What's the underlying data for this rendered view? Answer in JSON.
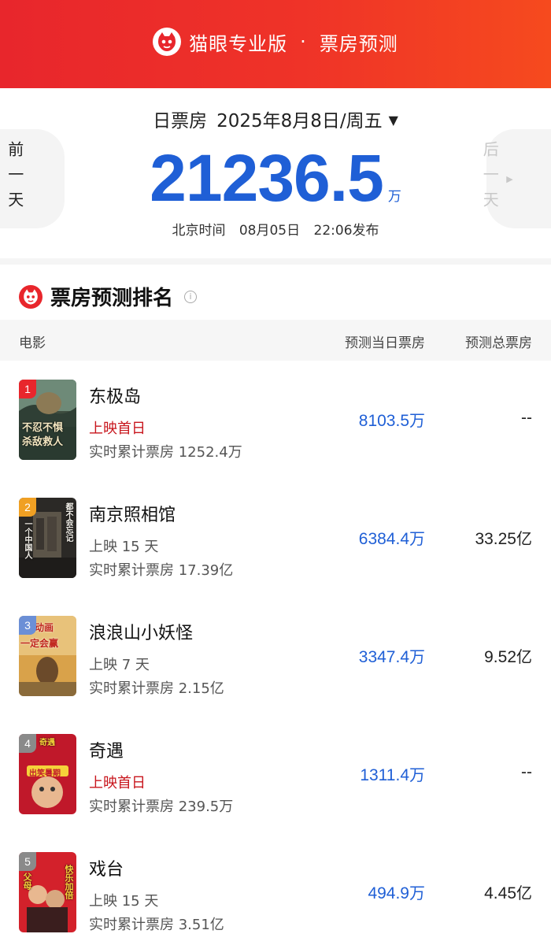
{
  "header": {
    "brand": "猫眼专业版",
    "separator": "·",
    "subtitle": "票房预测",
    "logo_icon": "cat-logo-icon"
  },
  "summary": {
    "label": "日票房",
    "date": "2025年8月8日/周五",
    "caret_icon": "caret-down-icon",
    "value": "21236.5",
    "unit": "万",
    "publish_prefix": "北京时间",
    "publish_date": "08月05日",
    "publish_time": "22:06发布",
    "prev_label": "前一天",
    "next_label": "后一天"
  },
  "ranking": {
    "title": "票房预测排名",
    "columns": [
      "电影",
      "预测当日票房",
      "预测总票房"
    ],
    "items": [
      {
        "rank": "1",
        "title": "东极岛",
        "status": "上映首日",
        "is_first_day": true,
        "cumulative": "实时累计票房 1252.4万",
        "daily_value": "8103.5",
        "daily_unit": "万",
        "total_value": "--",
        "total_unit": "",
        "poster_lines": [
          "不忍不惧",
          "杀敌救人"
        ],
        "badge_color": "#e8262c"
      },
      {
        "rank": "2",
        "title": "南京照相馆",
        "status": "上映 15 天",
        "is_first_day": false,
        "cumulative": "实时累计票房 17.39亿",
        "daily_value": "6384.4",
        "daily_unit": "万",
        "total_value": "33.25",
        "total_unit": "亿",
        "poster_lines": [
          "一个中国人",
          "都不会忘记"
        ],
        "badge_color": "#f0a023"
      },
      {
        "rank": "3",
        "title": "浪浪山小妖怪",
        "status": "上映 7 天",
        "is_first_day": false,
        "cumulative": "实时累计票房 2.15亿",
        "daily_value": "3347.4",
        "daily_unit": "万",
        "total_value": "9.52",
        "total_unit": "亿",
        "poster_lines": [
          "国动画",
          "一定会赢"
        ],
        "badge_color": "#6b8fd6"
      },
      {
        "rank": "4",
        "title": "奇遇",
        "status": "上映首日",
        "is_first_day": true,
        "cumulative": "实时累计票房 239.5万",
        "daily_value": "1311.4",
        "daily_unit": "万",
        "total_value": "--",
        "total_unit": "",
        "poster_lines": [
          "奇遇",
          "出笑暑期"
        ],
        "badge_color": "#8a8a8a"
      },
      {
        "rank": "5",
        "title": "戏台",
        "status": "上映 15 天",
        "is_first_day": false,
        "cumulative": "实时累计票房 3.51亿",
        "daily_value": "494.9",
        "daily_unit": "万",
        "total_value": "4.45",
        "total_unit": "亿",
        "poster_lines": [
          "父母",
          "快乐加倍"
        ],
        "badge_color": "#8a8a8a"
      }
    ]
  },
  "colors": {
    "header_red": "#e8262c",
    "accent_blue": "#1f5fd6",
    "first_day_red": "#c8161d"
  }
}
